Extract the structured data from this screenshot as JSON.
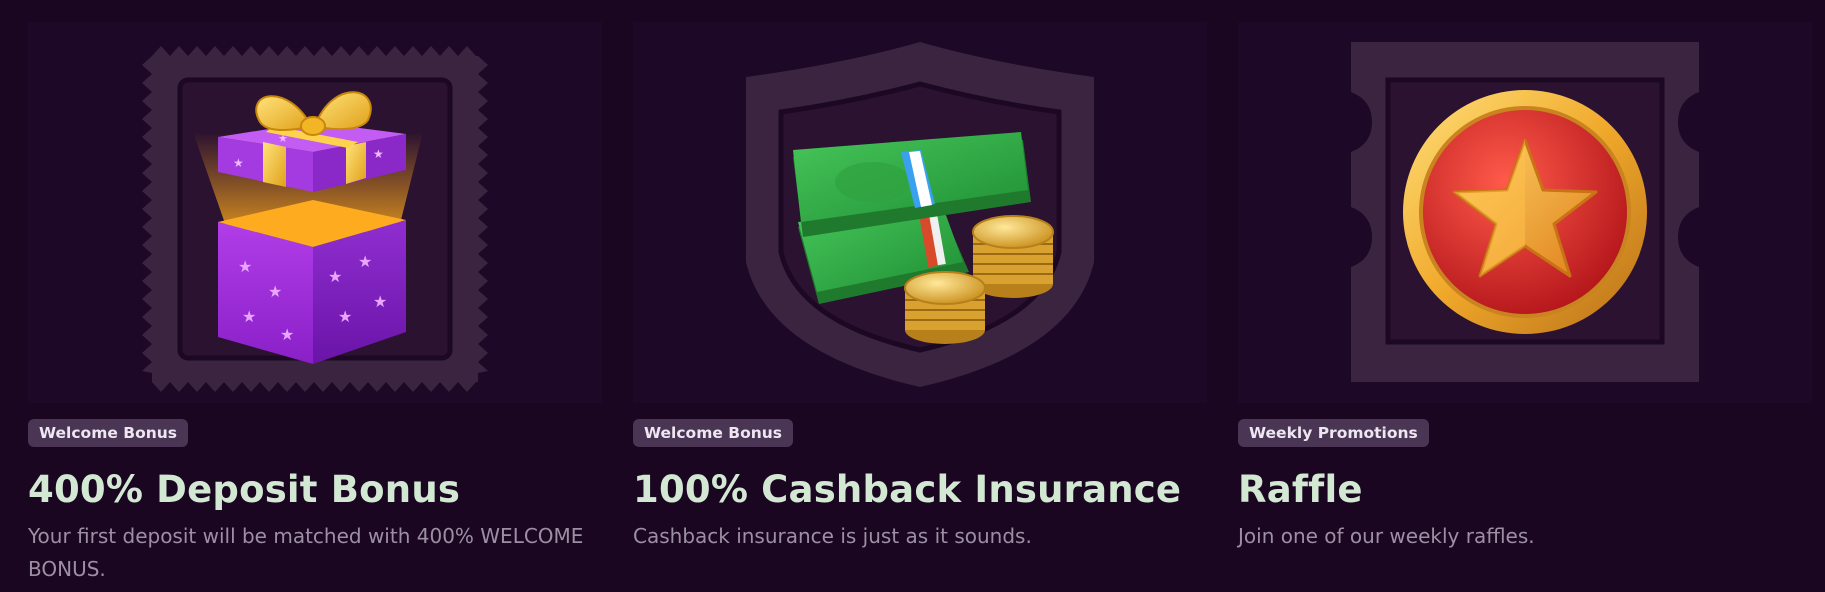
{
  "colors": {
    "background": "#1b0622",
    "badge_bg": "#4a3554",
    "title": "#d2e8d2",
    "description": "#9c8fa3"
  },
  "promotions": [
    {
      "icon": "gift-box-icon",
      "badge": "Welcome Bonus",
      "title": "400% Deposit Bonus",
      "description": "Your first deposit will be matched with 400% WELCOME BONUS."
    },
    {
      "icon": "cash-and-coins-icon",
      "badge": "Welcome Bonus",
      "title": "100% Cashback Insurance",
      "description": "Cashback insurance is just as it sounds."
    },
    {
      "icon": "star-medal-icon",
      "badge": "Weekly Promotions",
      "title": "Raffle",
      "description": "Join one of our weekly raffles."
    }
  ]
}
